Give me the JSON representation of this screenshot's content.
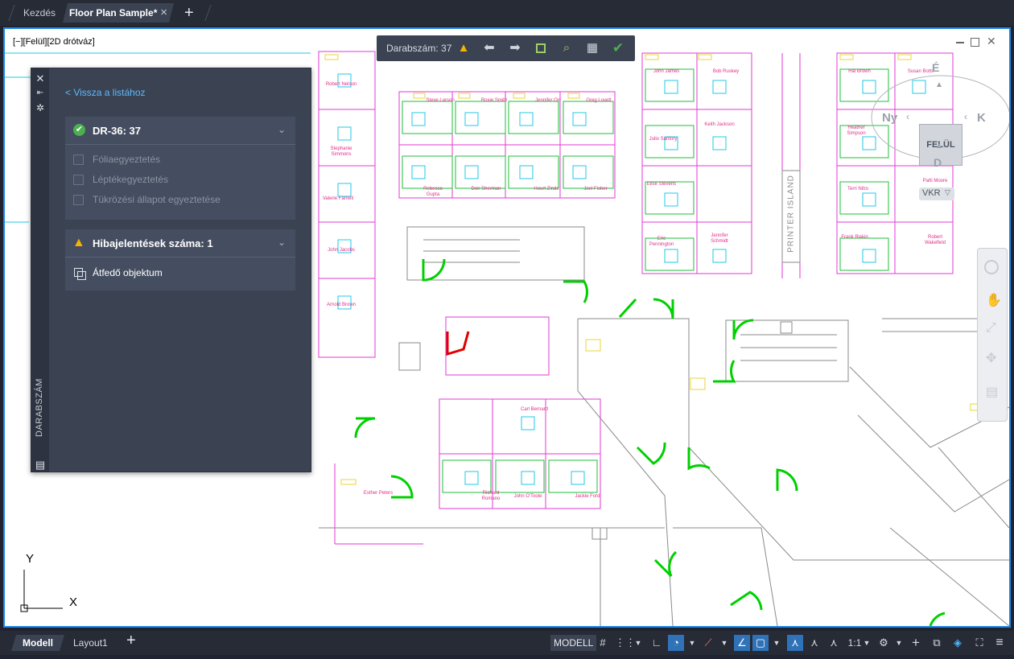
{
  "tabs": {
    "home": "Kezdés",
    "file": "Floor Plan Sample*",
    "close": "×",
    "add": "+"
  },
  "viewport": {
    "label": "[−][Felül][2D drótváz]"
  },
  "count_toolbar": {
    "label": "Darabszám:",
    "count": "37"
  },
  "panel": {
    "vertical_title": "DARABSZÁM",
    "back_link": "< Vissza a listához",
    "block_card": {
      "title": "DR-36: 37",
      "checks": [
        "Fóliaegyeztetés",
        "Léptékegyeztetés",
        "Tükrözési állapot egyeztetése"
      ]
    },
    "issues_card": {
      "title": "Hibajelentések száma: 1",
      "items": [
        "Átfedő objektum"
      ]
    }
  },
  "drawing": {
    "names": [
      "Robert Nelson",
      "Steve Larson",
      "Roxie Smith",
      "Jennifer Orr",
      "Greg Lovett",
      "John James",
      "Bob Ruskey",
      "Hal Brown",
      "Susan Botts",
      "Stephanie Simmons",
      "Julio Santory",
      "Keith Jackson",
      "Heather Simpson",
      "Valerie Farrelli",
      "Rebecca Gupta",
      "Don Sherman",
      "Hourt Zinde",
      "Joel Fisher",
      "Elise Stevens",
      "Terri Nitro",
      "Patti Moore",
      "John Jacobs",
      "Eric Pennington",
      "Jennifer Schmidt",
      "Frank Blakin",
      "Robert Wakefield",
      "Arnold Brown",
      "Carl Bernard",
      "Esther Peters",
      "Richard Romano",
      "John O'Toole",
      "Jackie Ford"
    ],
    "printer_island": "PRINTER ISLAND"
  },
  "viewcube": {
    "face": "FELÜL",
    "north": "É",
    "south": "D",
    "west": "Ny",
    "east": "K",
    "wcs": "VKR"
  },
  "ucs": {
    "x": "X",
    "y": "Y"
  },
  "bottom_tabs": {
    "model": "Modell",
    "layout": "Layout1",
    "add": "+"
  },
  "statusbar": {
    "model": "MODELL",
    "scale": "1:1"
  },
  "colors": {
    "accent": "#1e88e5",
    "success": "#4caf50",
    "warning": "#f5b400",
    "link": "#5db8ff"
  }
}
